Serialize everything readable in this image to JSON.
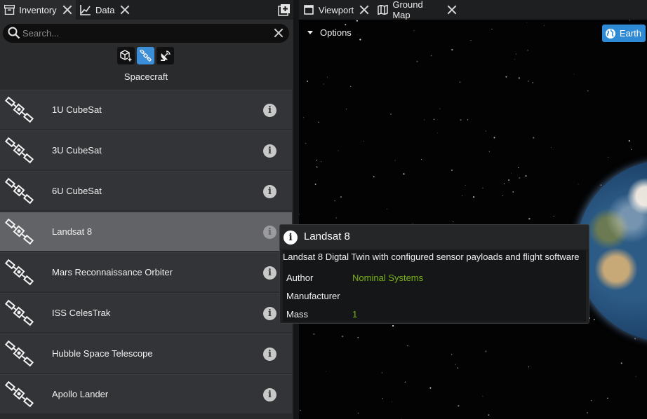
{
  "left_tabs": [
    {
      "label": "Inventory",
      "icon": "archive-icon"
    },
    {
      "label": "Data",
      "icon": "line-chart-icon"
    }
  ],
  "right_tabs": [
    {
      "label": "Viewport",
      "icon": "window-icon"
    },
    {
      "label": "Ground Map",
      "icon": "map-icon"
    }
  ],
  "search": {
    "placeholder": "Search..."
  },
  "filters": [
    {
      "name": "component",
      "icon": "cube-add-icon",
      "active": false
    },
    {
      "name": "spacecraft",
      "icon": "satellite-icon",
      "active": true
    },
    {
      "name": "ground-station",
      "icon": "antenna-icon",
      "active": false
    }
  ],
  "category_label": "Spacecraft",
  "items": [
    {
      "label": "1U CubeSat"
    },
    {
      "label": "3U CubeSat"
    },
    {
      "label": "6U CubeSat"
    },
    {
      "label": "Landsat 8"
    },
    {
      "label": "Mars Reconnaissance Orbiter"
    },
    {
      "label": "ISS CelesTrak"
    },
    {
      "label": "Hubble Space Telescope"
    },
    {
      "label": "Apollo Lander"
    }
  ],
  "viewport": {
    "options_label": "Options",
    "earth_button": "Earth"
  },
  "tooltip": {
    "title": "Landsat 8",
    "description": "Landsat 8 Digtal Twin with configured sensor payloads and flight software",
    "author_label": "Author",
    "author_value": "Nominal Systems",
    "manufacturer_label": "Manufacturer",
    "manufacturer_value": "",
    "mass_label": "Mass",
    "mass_value": "1"
  },
  "colors": {
    "accent": "#3b8fd8",
    "value_green": "#7ab317"
  }
}
